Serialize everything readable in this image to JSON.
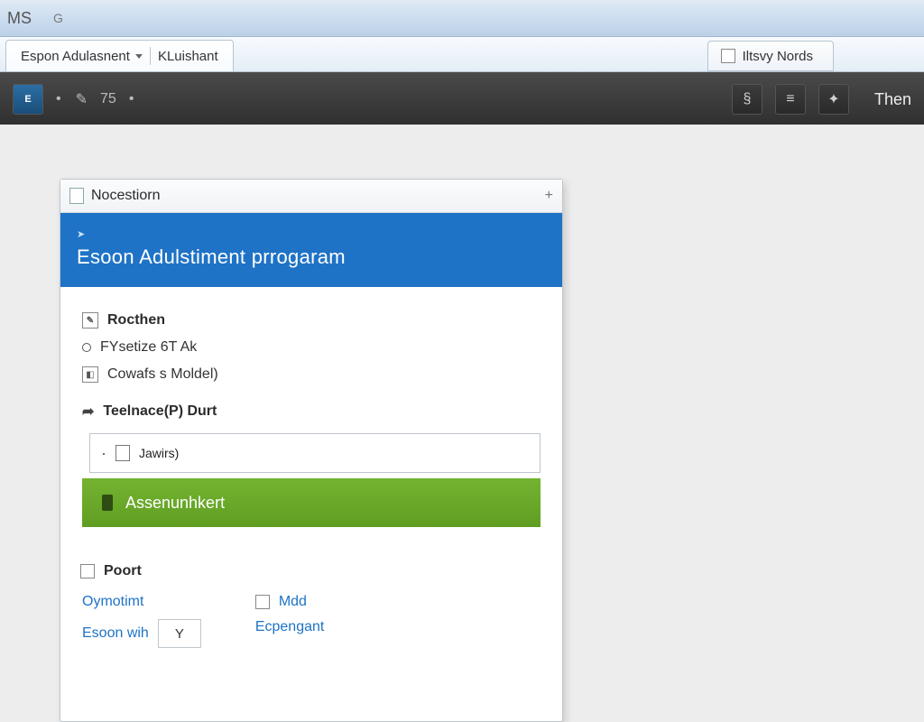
{
  "titlebar": {
    "left": "MS",
    "secondary": "G"
  },
  "tabs": {
    "tab1": "Espon Adulasnent",
    "tab2": "KLuishant",
    "right": "Iltsvy Nords"
  },
  "toolbar": {
    "app_label": "E",
    "zoom": "75",
    "right_text": "Then"
  },
  "panel": {
    "header": "Nocestiorn",
    "banner_title": "Esoon Adulstiment prrogaram",
    "rows": {
      "section1": "Rocthen",
      "item1": "FYsetize 6T Ak",
      "item2": "Cowafs s Moldel)",
      "section2": "Teelnace(P) Durt",
      "dropdown": "Jawirs)",
      "greenbar": "Assenunhkert"
    },
    "port": {
      "label": "Poort",
      "link1": "Oymotimt",
      "link2": "Mdd",
      "row2_label": "Esoon wih",
      "row2_value": "Y",
      "row2_link": "Ecpengant"
    }
  }
}
